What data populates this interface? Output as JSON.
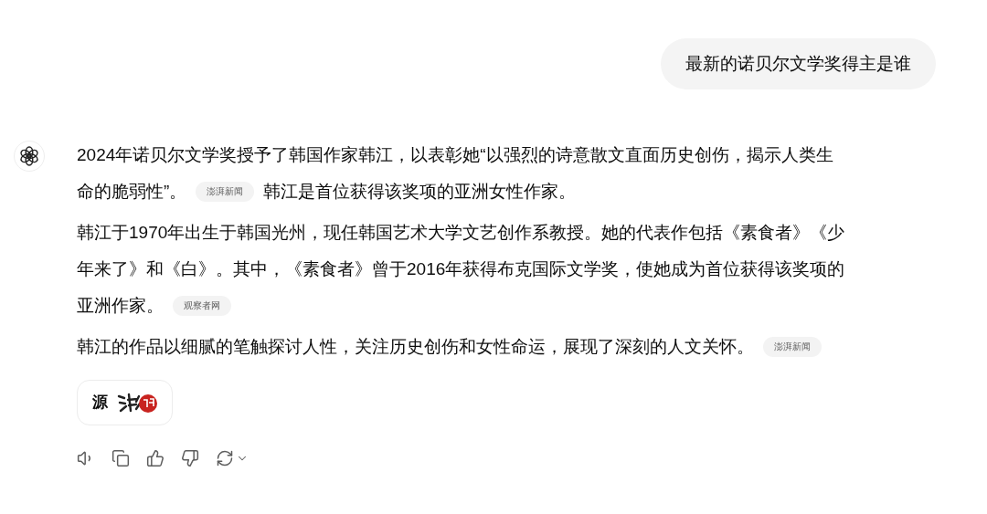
{
  "user_message": {
    "text": "最新的诺贝尔文学奖得主是谁"
  },
  "answer": {
    "paragraphs": [
      {
        "lines": [
          [
            {
              "kind": "text",
              "text": "2024年诺贝尔文学奖授予了韩国作家韩江，以表彰她“以强烈的诗意散文直面历史创伤，揭示人类生"
            }
          ],
          [
            {
              "kind": "text",
              "text": "命的脆弱性”。"
            },
            {
              "kind": "citation",
              "text": "澎湃新闻"
            },
            {
              "kind": "text",
              "text": "韩江是首位获得该奖项的亚洲女性作家。"
            }
          ]
        ]
      },
      {
        "lines": [
          [
            {
              "kind": "text",
              "text": "韩江于1970年出生于韩国光州，现任韩国艺术大学文艺创作系教授。她的代表作包括《素食者》《少"
            }
          ],
          [
            {
              "kind": "text",
              "text": "年来了》和《白》。其中，《素食者》曾于2016年获得布克国际文学奖，使她成为首位获得该奖项的"
            }
          ],
          [
            {
              "kind": "text",
              "text": "亚洲作家。"
            },
            {
              "kind": "citation",
              "text": "观察者网"
            }
          ]
        ]
      },
      {
        "lines": [
          [
            {
              "kind": "text",
              "text": "韩江的作品以细腻的笔触探讨人性，关注历史创伤和女性命运，展现了深刻的人文关怀。"
            },
            {
              "kind": "citation",
              "text": "澎湃新闻"
            }
          ]
        ]
      }
    ],
    "sources_button": {
      "label": "源"
    },
    "actions": [
      {
        "kind": "speak"
      },
      {
        "kind": "copy"
      },
      {
        "kind": "like"
      },
      {
        "kind": "dislike"
      },
      {
        "kind": "regenerate"
      }
    ]
  }
}
